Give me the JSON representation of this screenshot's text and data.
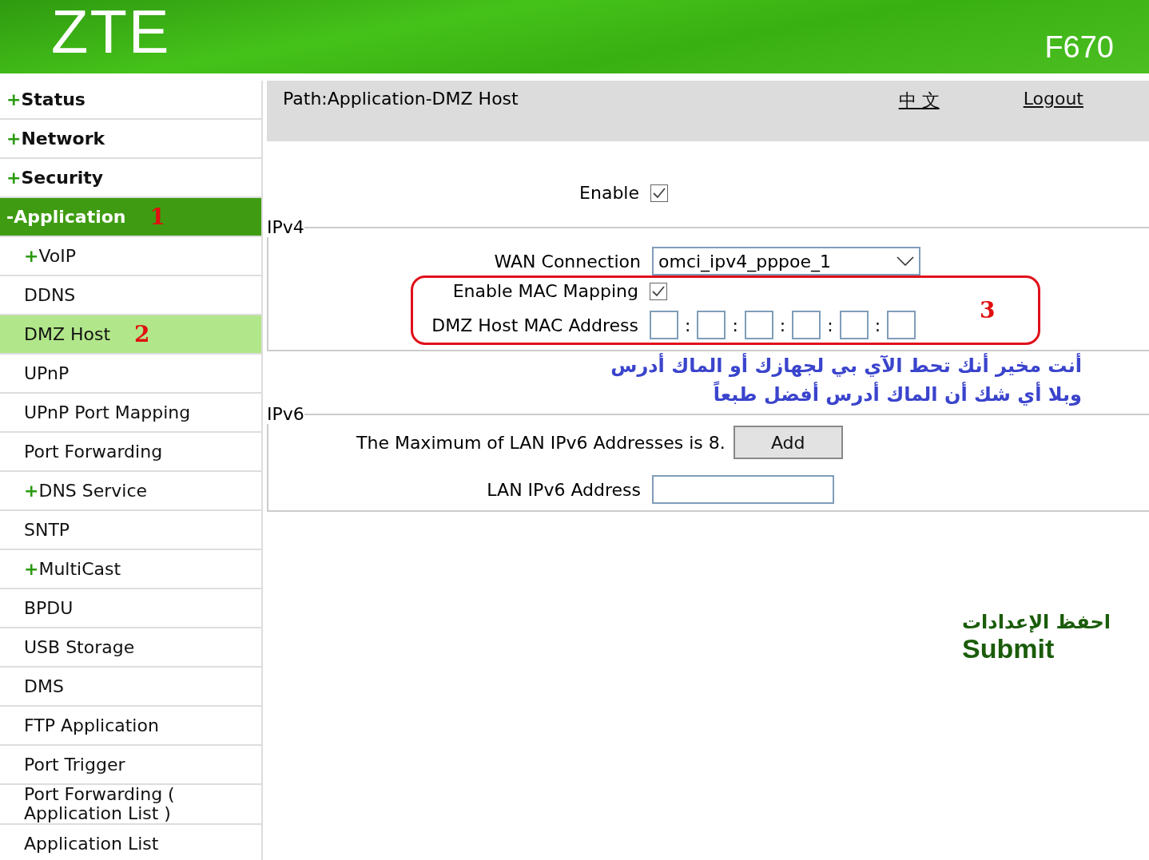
{
  "header": {
    "logo": "ZTE",
    "model": "F670"
  },
  "sidebar": {
    "items": [
      {
        "sign": "+",
        "label": "Status",
        "kind": "group",
        "selected": false
      },
      {
        "sign": "+",
        "label": "Network",
        "kind": "group",
        "selected": false
      },
      {
        "sign": "+",
        "label": "Security",
        "kind": "group",
        "selected": false
      },
      {
        "sign": "-",
        "label": "Application",
        "kind": "group",
        "selected": true,
        "note": "1"
      },
      {
        "sign": "+",
        "label": "VoIP",
        "kind": "sub",
        "selected": false
      },
      {
        "label": "DDNS",
        "kind": "sub",
        "selected": false
      },
      {
        "label": "DMZ Host",
        "kind": "sub",
        "selected": true,
        "note": "2"
      },
      {
        "label": "UPnP",
        "kind": "sub",
        "selected": false
      },
      {
        "label": "UPnP Port Mapping",
        "kind": "sub",
        "selected": false
      },
      {
        "label": "Port Forwarding",
        "kind": "sub",
        "selected": false
      },
      {
        "sign": "+",
        "label": "DNS Service",
        "kind": "sub",
        "selected": false
      },
      {
        "label": "SNTP",
        "kind": "sub",
        "selected": false
      },
      {
        "sign": "+",
        "label": "MultiCast",
        "kind": "sub",
        "selected": false
      },
      {
        "label": "BPDU",
        "kind": "sub",
        "selected": false
      },
      {
        "label": "USB Storage",
        "kind": "sub",
        "selected": false
      },
      {
        "label": "DMS",
        "kind": "sub",
        "selected": false
      },
      {
        "label": "FTP Application",
        "kind": "sub",
        "selected": false
      },
      {
        "label": "Port Trigger",
        "kind": "sub",
        "selected": false
      },
      {
        "label": "Port Forwarding ( Application List )",
        "kind": "sub",
        "selected": false
      },
      {
        "label": "Application List",
        "kind": "sub",
        "selected": false
      }
    ]
  },
  "path_bar": {
    "path": "Path:Application-DMZ Host",
    "links": [
      "中 文",
      "Logout"
    ]
  },
  "enable": {
    "label": "Enable",
    "checked": true
  },
  "ipv4": {
    "legend": "IPv4",
    "wan_connection": {
      "label": "WAN Connection",
      "value": "omci_ipv4_pppoe_1"
    },
    "enable_mac_mapping": {
      "label": "Enable MAC Mapping",
      "checked": true
    },
    "mac_address": {
      "label": "DMZ Host MAC Address",
      "separators": [
        ":",
        ":",
        ":",
        ":",
        ":"
      ]
    },
    "note": "3"
  },
  "arabic_note": [
    "أنت مخير أنك تحط الآي بي لجهازك أو الماك أدرس",
    "وبلا أي شك أن الماك أدرس أفضل طبعاً"
  ],
  "ipv6": {
    "legend": "IPv6",
    "max_text": "The Maximum of LAN IPv6 Addresses is 8.",
    "add_button": "Add",
    "lan_address": {
      "label": "LAN IPv6 Address"
    }
  },
  "submit": {
    "hint": "احفظ الإعدادات",
    "label": "Submit"
  }
}
